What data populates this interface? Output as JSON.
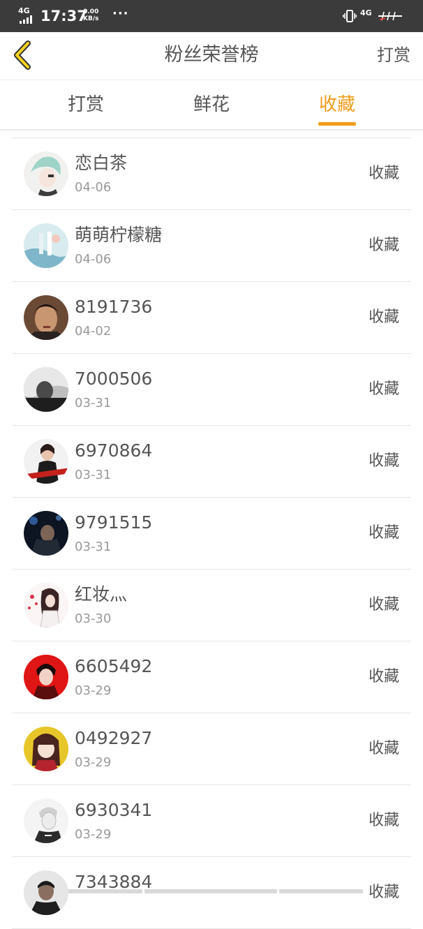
{
  "status_bar": {
    "network_left": "4G",
    "time": "17:37",
    "speed_value": "0.00",
    "speed_unit": "KB/s",
    "more": "···",
    "network_right": "4G"
  },
  "header": {
    "title": "粉丝荣誉榜",
    "right_action": "打赏"
  },
  "tabs": [
    {
      "label": "打赏",
      "active": false
    },
    {
      "label": "鲜花",
      "active": false
    },
    {
      "label": "收藏",
      "active": true
    }
  ],
  "colors": {
    "accent": "#f09c1d",
    "status_bar_bg": "#3b3b3b"
  },
  "list": [
    {
      "name": "恋白茶",
      "date": "04-06",
      "action": "收藏"
    },
    {
      "name": "萌萌柠檬糖",
      "date": "04-06",
      "action": "收藏"
    },
    {
      "name": "8191736",
      "date": "04-02",
      "action": "收藏"
    },
    {
      "name": "7000506",
      "date": "03-31",
      "action": "收藏"
    },
    {
      "name": "6970864",
      "date": "03-31",
      "action": "收藏"
    },
    {
      "name": "9791515",
      "date": "03-31",
      "action": "收藏"
    },
    {
      "name": "红妆灬",
      "date": "03-30",
      "action": "收藏"
    },
    {
      "name": "6605492",
      "date": "03-29",
      "action": "收藏"
    },
    {
      "name": "0492927",
      "date": "03-29",
      "action": "收藏"
    },
    {
      "name": "6930341",
      "date": "03-29",
      "action": "收藏"
    },
    {
      "name": "7343884",
      "date": "",
      "action": "收藏"
    }
  ]
}
